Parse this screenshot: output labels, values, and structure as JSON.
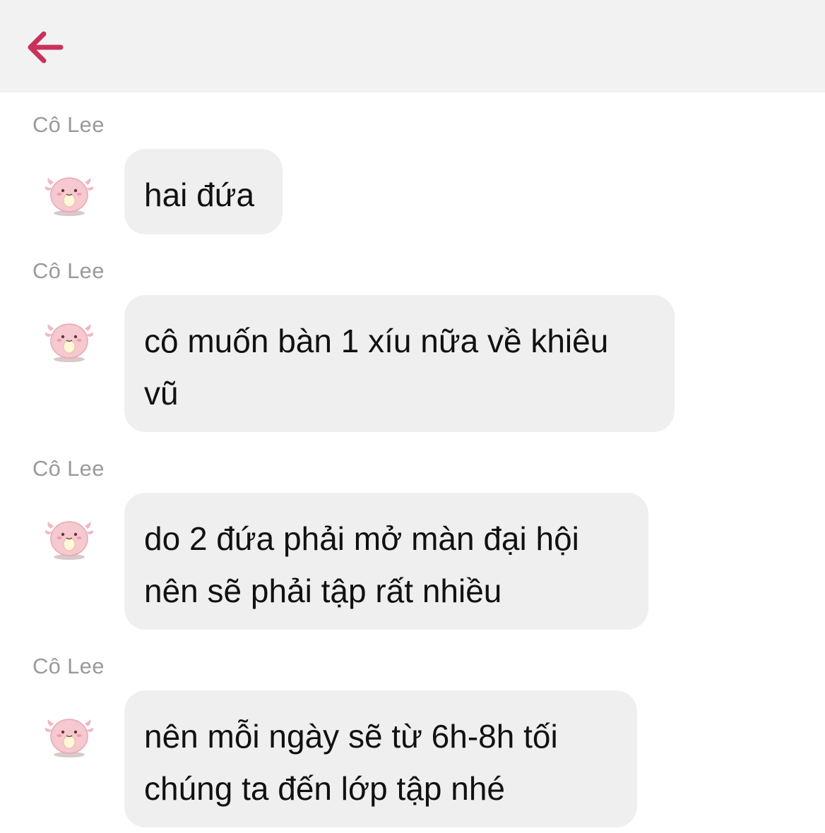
{
  "header": {
    "back_icon": "arrow-left-icon",
    "accent_color": "#c8325a",
    "background": "#f2f2f2"
  },
  "messages": [
    {
      "sender": "Cô Lee",
      "avatar_icon": "pink-creature-avatar-icon",
      "lines": [
        "hai đứa"
      ]
    },
    {
      "sender": "Cô Lee",
      "avatar_icon": "pink-creature-avatar-icon",
      "lines": [
        "cô muốn bàn 1 xíu nữa về khiêu",
        "vũ"
      ]
    },
    {
      "sender": "Cô Lee",
      "avatar_icon": "pink-creature-avatar-icon",
      "lines": [
        "do 2 đứa phải mở màn đại hội",
        "nên sẽ phải tập rất nhiều"
      ]
    },
    {
      "sender": "Cô Lee",
      "avatar_icon": "pink-creature-avatar-icon",
      "lines": [
        "nên mỗi ngày sẽ từ 6h-8h tối",
        "chúng ta đến lớp tập nhé"
      ]
    }
  ]
}
